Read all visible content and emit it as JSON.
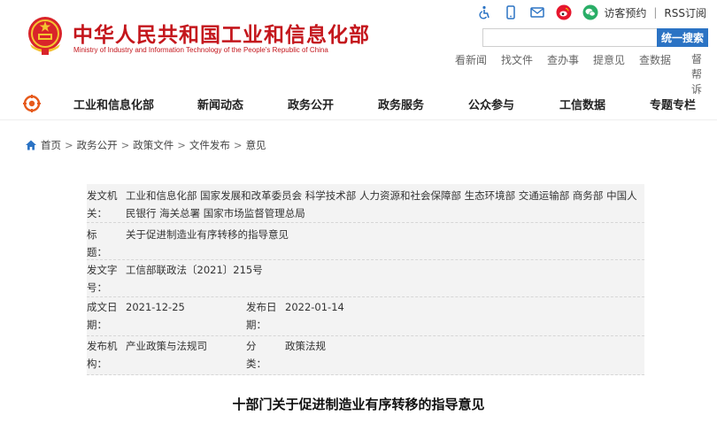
{
  "header": {
    "title": "中华人民共和国工业和信息化部",
    "subtitle": "Ministry of Industry and Information Technology of the People's Republic of China",
    "topbar": {
      "icons": [
        "accessibility-icon",
        "mobile-icon",
        "email-icon",
        "weibo-icon",
        "wechat-icon"
      ],
      "visitor_label": "访客预约",
      "separator": "|",
      "rss_label": "RSS订阅"
    },
    "search": {
      "placeholder": "",
      "button_label": "统一搜索"
    },
    "quick_links": [
      "看新闻",
      "找文件",
      "查办事",
      "提意见",
      "查数据",
      "督帮诉"
    ]
  },
  "nav": {
    "items": [
      "工业和信息化部",
      "新闻动态",
      "政务公开",
      "政务服务",
      "公众参与",
      "工信数据",
      "专题专栏"
    ]
  },
  "breadcrumb": {
    "items": [
      "首页",
      "政务公开",
      "政策文件",
      "文件发布",
      "意见"
    ],
    "separator": ">"
  },
  "info": {
    "issuer_label": "发文机关：",
    "issuer": "工业和信息化部 国家发展和改革委员会 科学技术部 人力资源和社会保障部 生态环境部 交通运输部 商务部 中国人民银行 海关总署 国家市场监督管理总局",
    "title_label": "标　　题：",
    "title": "关于促进制造业有序转移的指导意见",
    "number_label": "发文字号：",
    "number": "工信部联政法〔2021〕215号",
    "written_label": "成文日期：",
    "written": "2021-12-25",
    "published_label": "发布日期：",
    "published": "2022-01-14",
    "org_label": "发布机构：",
    "org": "产业政策与法规司",
    "category_label": "分　　类：",
    "category": "政策法规"
  },
  "document": {
    "title": "十部门关于促进制造业有序转移的指导意见"
  },
  "colors": {
    "brand_red": "#c4161c",
    "search_blue": "#2b73c4",
    "weibo_red": "#e6162d",
    "wechat_green": "#2aae67"
  }
}
